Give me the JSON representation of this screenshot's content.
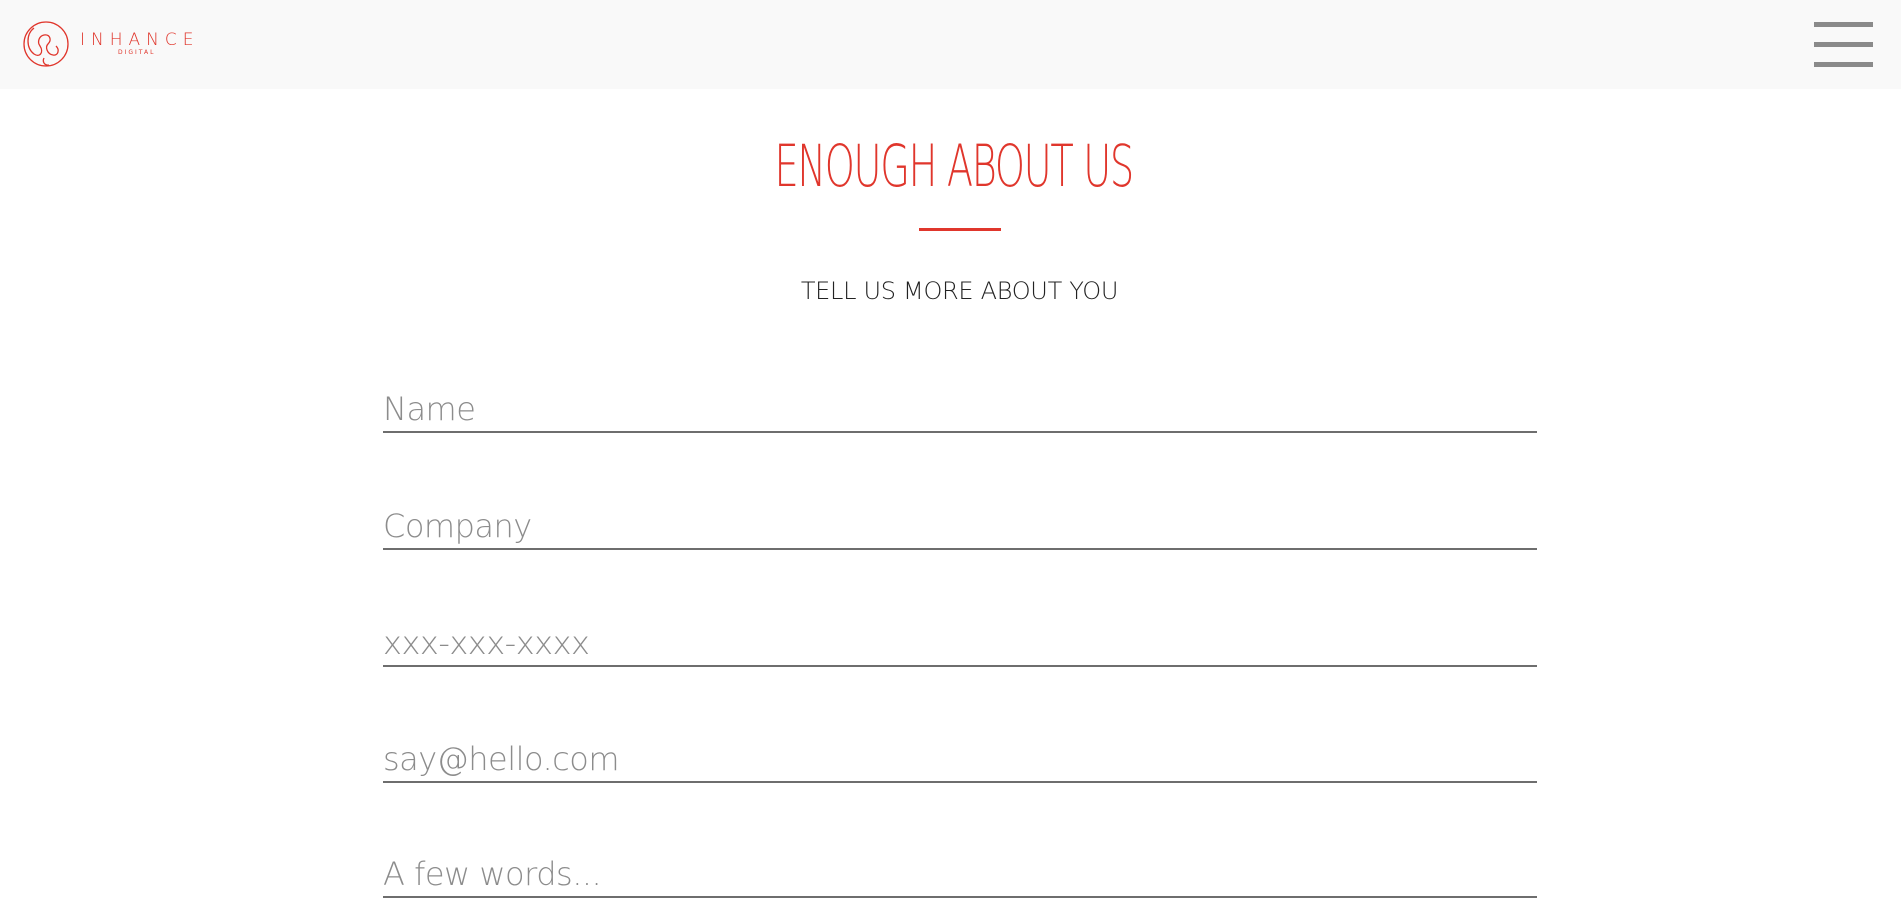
{
  "header": {
    "logo": {
      "name": "INHANCE",
      "sub": "DIGITAL",
      "icon": "inhance-logo-icon"
    },
    "menu_icon": "hamburger-menu-icon"
  },
  "main": {
    "title": "ENOUGH ABOUT US",
    "subtitle": "TELL US MORE ABOUT YOU",
    "form": {
      "name": {
        "placeholder": "Name",
        "value": ""
      },
      "company": {
        "placeholder": "Company",
        "value": ""
      },
      "phone": {
        "placeholder": "xxx-xxx-xxxx",
        "value": ""
      },
      "email": {
        "placeholder": "say@hello.com",
        "value": ""
      },
      "message": {
        "placeholder": "A few words...",
        "value": ""
      }
    }
  },
  "colors": {
    "accent": "#e0362c",
    "header_bg": "#f9f9f9",
    "menu_bars": "#8a8a8a",
    "field_underline": "#6e6e6e",
    "placeholder": "#8c8c8c"
  }
}
